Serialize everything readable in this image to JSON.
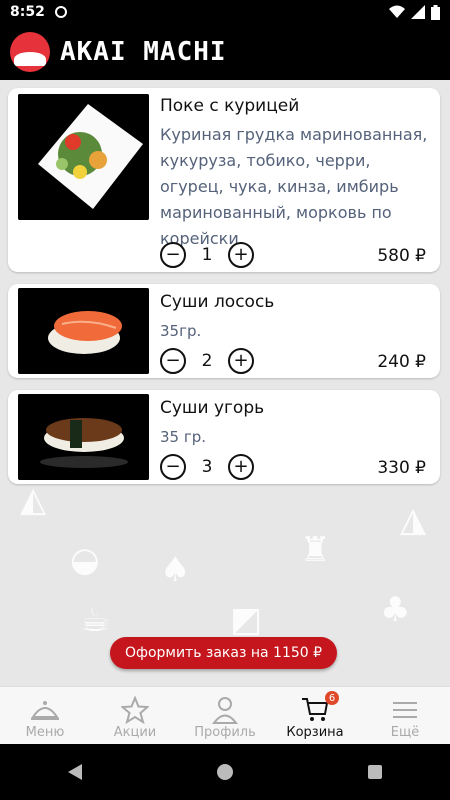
{
  "status": {
    "time": "8:52"
  },
  "app": {
    "logo_text": "AKAI MACHI"
  },
  "items": [
    {
      "title": "Поке с курицей",
      "desc": "Куриная грудка маринованная, кукуруза, тобико, черри, огурец, чука, кинза, имбирь маринованный, морковь по корейски.",
      "qty": "1",
      "price": "580 ₽"
    },
    {
      "title": "Суши лосось",
      "desc": "35гр.",
      "qty": "2",
      "price": "240 ₽"
    },
    {
      "title": "Суши угорь",
      "desc": "35 гр.",
      "qty": "3",
      "price": "330 ₽"
    }
  ],
  "order": {
    "label": "Оформить заказ на 1150 ₽"
  },
  "tabs": [
    {
      "label": "Меню",
      "icon": "cloche-icon"
    },
    {
      "label": "Акции",
      "icon": "star-icon"
    },
    {
      "label": "Профиль",
      "icon": "profile-icon"
    },
    {
      "label": "Корзина",
      "icon": "cart-icon",
      "badge": "6"
    },
    {
      "label": "Ещё",
      "icon": "menu-icon"
    }
  ],
  "colors": {
    "accent": "#c4161c",
    "badge": "#e0482a"
  }
}
